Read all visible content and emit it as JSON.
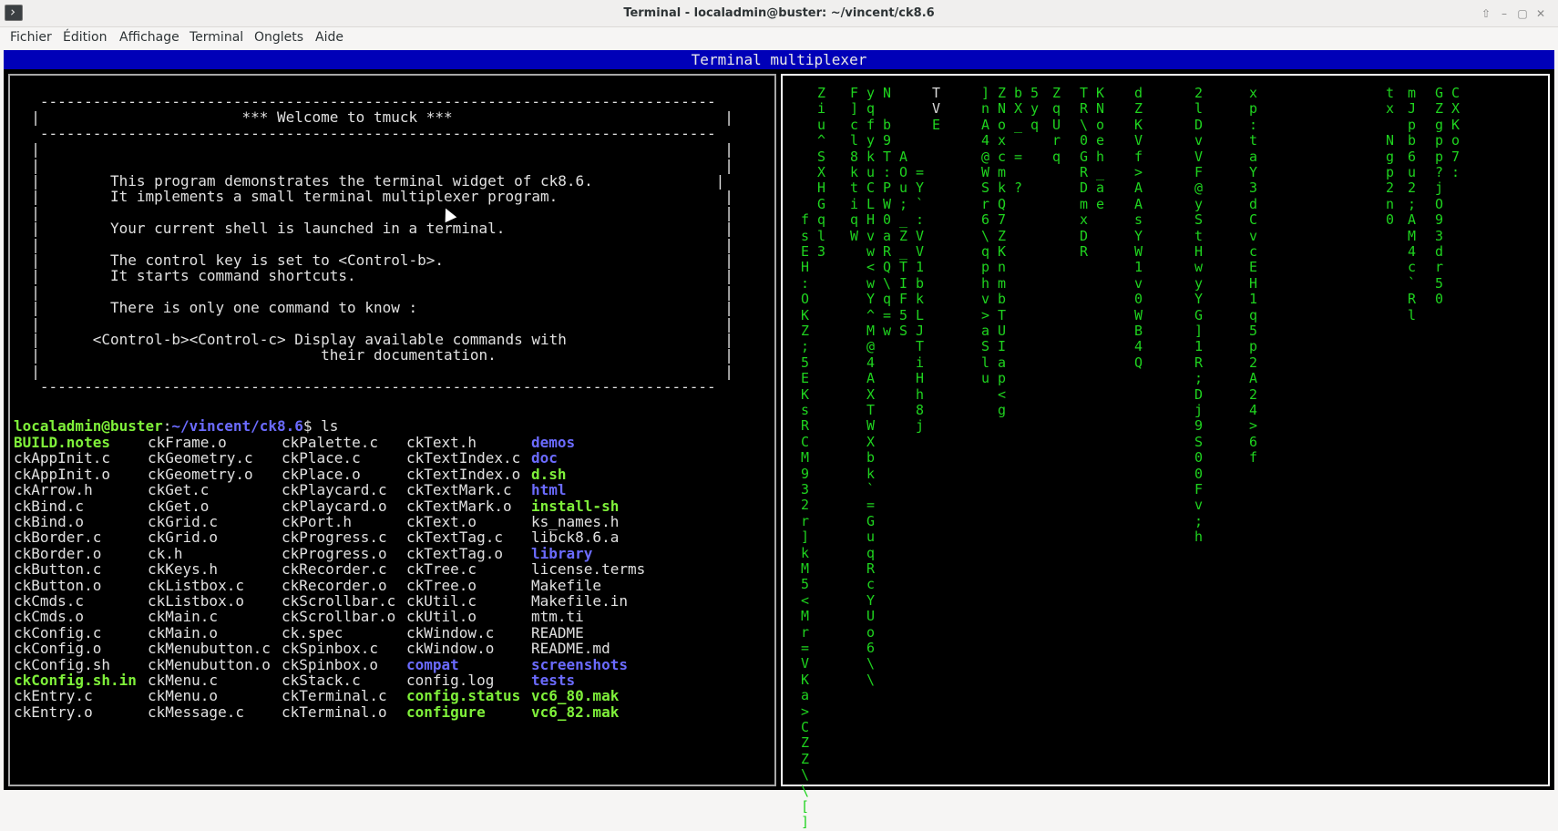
{
  "window": {
    "title": "Terminal - localadmin@buster: ~/vincent/ck8.6",
    "buttons": [
      "⇧",
      "–",
      "▢",
      "✕"
    ]
  },
  "menu": [
    "Fichier",
    "Édition",
    "Affichage",
    "Terminal",
    "Onglets",
    "Aide"
  ],
  "mux_title": "Terminal multiplexer",
  "banner": [
    "   -----------------------------------------------------------------------------",
    "  |                       *** Welcome to tmuck ***                               |",
    "   -----------------------------------------------------------------------------",
    "  |                                                                              |",
    "  |                                                                              |",
    "  |        This program demonstrates the terminal widget of ck8.6.              |",
    "  |        It implements a small terminal multiplexer program.                   |",
    "  |                                                                              |",
    "  |        Your current shell is launched in a terminal.                         |",
    "  |                                                                              |",
    "  |        The control key is set to <Control-b>.                                |",
    "  |        It starts command shortcuts.                                          |",
    "  |                                                                              |",
    "  |        There is only one command to know :                                   |",
    "  |                                                                              |",
    "  |      <Control-b><Control-c> Display available commands with                  |",
    "  |                                their documentation.                          |",
    "  |                                                                              |",
    "   -----------------------------------------------------------------------------"
  ],
  "prompt": {
    "user": "localadmin@buster",
    "path": "~/vincent/ck8.6",
    "cmd": "$ ls"
  },
  "ls_columns": [
    [
      [
        "BUILD.notes",
        "exe"
      ],
      [
        "ckAppInit.c",
        "plain"
      ],
      [
        "ckAppInit.o",
        "plain"
      ],
      [
        "ckArrow.h",
        "plain"
      ],
      [
        "ckBind.c",
        "plain"
      ],
      [
        "ckBind.o",
        "plain"
      ],
      [
        "ckBorder.c",
        "plain"
      ],
      [
        "ckBorder.o",
        "plain"
      ],
      [
        "ckButton.c",
        "plain"
      ],
      [
        "ckButton.o",
        "plain"
      ],
      [
        "ckCmds.c",
        "plain"
      ],
      [
        "ckCmds.o",
        "plain"
      ],
      [
        "ckConfig.c",
        "plain"
      ],
      [
        "ckConfig.o",
        "plain"
      ],
      [
        "ckConfig.sh",
        "plain"
      ],
      [
        "ckConfig.sh.in",
        "exe"
      ],
      [
        "ckEntry.c",
        "plain"
      ],
      [
        "ckEntry.o",
        "plain"
      ]
    ],
    [
      [
        "ckFrame.o",
        "plain"
      ],
      [
        "ckGeometry.c",
        "plain"
      ],
      [
        "ckGeometry.o",
        "plain"
      ],
      [
        "ckGet.c",
        "plain"
      ],
      [
        "ckGet.o",
        "plain"
      ],
      [
        "ckGrid.c",
        "plain"
      ],
      [
        "ckGrid.o",
        "plain"
      ],
      [
        "ck.h",
        "plain"
      ],
      [
        "ckKeys.h",
        "plain"
      ],
      [
        "ckListbox.c",
        "plain"
      ],
      [
        "ckListbox.o",
        "plain"
      ],
      [
        "ckMain.c",
        "plain"
      ],
      [
        "ckMain.o",
        "plain"
      ],
      [
        "ckMenubutton.c",
        "plain"
      ],
      [
        "ckMenubutton.o",
        "plain"
      ],
      [
        "ckMenu.c",
        "plain"
      ],
      [
        "ckMenu.o",
        "plain"
      ],
      [
        "ckMessage.c",
        "plain"
      ]
    ],
    [
      [
        "ckPalette.c",
        "plain"
      ],
      [
        "ckPlace.c",
        "plain"
      ],
      [
        "ckPlace.o",
        "plain"
      ],
      [
        "ckPlaycard.c",
        "plain"
      ],
      [
        "ckPlaycard.o",
        "plain"
      ],
      [
        "ckPort.h",
        "plain"
      ],
      [
        "ckProgress.c",
        "plain"
      ],
      [
        "ckProgress.o",
        "plain"
      ],
      [
        "ckRecorder.c",
        "plain"
      ],
      [
        "ckRecorder.o",
        "plain"
      ],
      [
        "ckScrollbar.c",
        "plain"
      ],
      [
        "ckScrollbar.o",
        "plain"
      ],
      [
        "ck.spec",
        "plain"
      ],
      [
        "ckSpinbox.c",
        "plain"
      ],
      [
        "ckSpinbox.o",
        "plain"
      ],
      [
        "ckStack.c",
        "plain"
      ],
      [
        "ckTerminal.c",
        "plain"
      ],
      [
        "ckTerminal.o",
        "plain"
      ]
    ],
    [
      [
        "ckText.h",
        "plain"
      ],
      [
        "ckTextIndex.c",
        "plain"
      ],
      [
        "ckTextIndex.o",
        "plain"
      ],
      [
        "ckTextMark.c",
        "plain"
      ],
      [
        "ckTextMark.o",
        "plain"
      ],
      [
        "ckText.o",
        "plain"
      ],
      [
        "ckTextTag.c",
        "plain"
      ],
      [
        "ckTextTag.o",
        "plain"
      ],
      [
        "ckTree.c",
        "plain"
      ],
      [
        "ckTree.o",
        "plain"
      ],
      [
        "ckUtil.c",
        "plain"
      ],
      [
        "ckUtil.o",
        "plain"
      ],
      [
        "ckWindow.c",
        "plain"
      ],
      [
        "ckWindow.o",
        "plain"
      ],
      [
        "compat",
        "dir"
      ],
      [
        "config.log",
        "plain"
      ],
      [
        "config.status",
        "exe"
      ],
      [
        "configure",
        "exe"
      ]
    ],
    [
      [
        "demos",
        "dir"
      ],
      [
        "doc",
        "dir"
      ],
      [
        "d.sh",
        "exe"
      ],
      [
        "html",
        "dir"
      ],
      [
        "install-sh",
        "exe"
      ],
      [
        "ks_names.h",
        "plain"
      ],
      [
        "libck8.6.a",
        "plain"
      ],
      [
        "library",
        "dir"
      ],
      [
        "license.terms",
        "plain"
      ],
      [
        "Makefile",
        "plain"
      ],
      [
        "Makefile.in",
        "plain"
      ],
      [
        "mtm.ti",
        "plain"
      ],
      [
        "README",
        "plain"
      ],
      [
        "README.md",
        "plain"
      ],
      [
        "screenshots",
        "dir"
      ],
      [
        "tests",
        "dir"
      ],
      [
        "vc6_80.mak",
        "exe"
      ],
      [
        "vc6_82.mak",
        "exe"
      ]
    ]
  ],
  "matrix_streams": [
    {
      "text": "fsEH:OKZ;5EKsRCM932r]kM5<Mr=VKa>CZZ\\\\[]",
      "bright": "",
      "start": 8
    },
    {
      "text": "Ziu^SXHGql3",
      "bright": "",
      "start": 0
    },
    {
      "text": "F]cl8ktiqW",
      "bright": "",
      "start": 0
    },
    {
      "text": "yqfykuCLHvw<wY^M@4AXTWXbk`=GuqRcYUo6\\\\",
      "bright": "",
      "start": 0
    },
    {
      "text": "N b9T:PW0aRQ\\q=w",
      "bright": "",
      "start": 0
    },
    {
      "text": "AOu;_Z_TIF5S",
      "bright": "",
      "start": 4
    },
    {
      "text": "=Y`:VV1bkLJTiHh8j",
      "bright": "",
      "start": 5
    },
    {
      "text": "TVE",
      "bright": "TV",
      "start": 0
    },
    {
      "text": "]nA4@WSr6\\qphv>aSlu",
      "bright": "",
      "start": 0
    },
    {
      "text": "ZNoxcmkQ7ZKnmbTUIap<g",
      "bright": "",
      "start": 0
    },
    {
      "text": "bX_ = ?",
      "bright": "",
      "start": 0
    },
    {
      "text": "5yq",
      "bright": "",
      "start": 0
    },
    {
      "text": "ZqUrq",
      "bright": "",
      "start": 0
    },
    {
      "text": "TR\\0GRDmxDR",
      "bright": "",
      "start": 0
    },
    {
      "text": "KNoeh_ae",
      "bright": "",
      "start": 0
    },
    {
      "text": "dZKVf>AAsYW1v0WB4Q",
      "bright": "",
      "start": 0
    },
    {
      "text": "2lDvVF@yStHwyYG]1R;Dj9S00Fv;h",
      "bright": "",
      "start": 0
    },
    {
      "text": "xp:taY3dCvcEH1q5p2A24>6f",
      "bright": "",
      "start": 0
    },
    {
      "text": "tx Ngp2n0",
      "bright": "",
      "start": 0
    },
    {
      "text": "mJpb6u2;AM4c`Rl",
      "bright": "",
      "start": 0
    },
    {
      "text": "GZgpp?jO93dr50",
      "bright": "",
      "start": 0
    },
    {
      "text": "CXKo7:",
      "bright": "",
      "start": 0
    }
  ]
}
